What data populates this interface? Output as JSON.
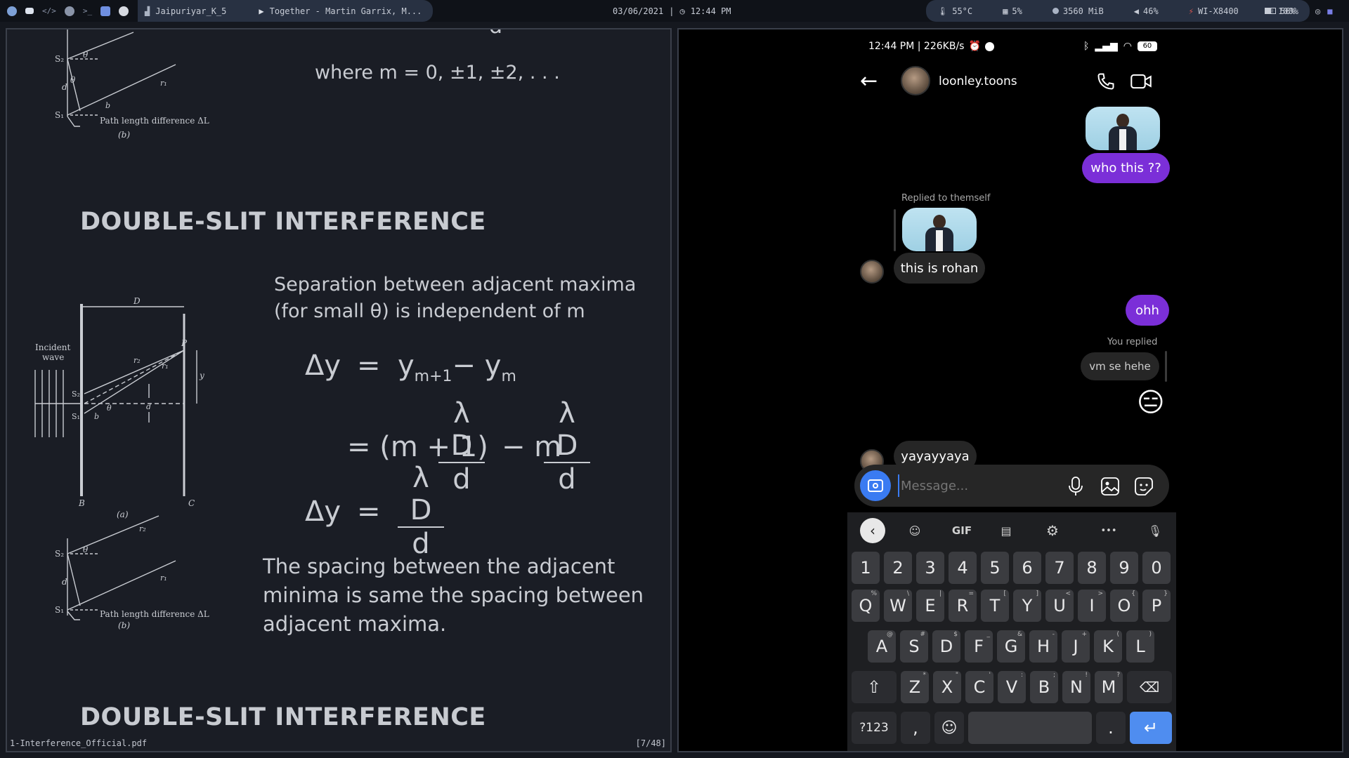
{
  "topbar": {
    "workspace_title": "Jaipuriyar_K_5",
    "media_title": "Together - Martin Garrix, M...",
    "date": "03/06/2021",
    "separator": "|",
    "time": "12:44 PM",
    "temp": "55°C",
    "cpu": "5%",
    "mem": "3560 MiB",
    "volume": "46%",
    "wifi": "WI-X8400",
    "brightness": "100%",
    "battery": "56%"
  },
  "pdf": {
    "top_cut_text": "d",
    "where_line": "where m = 0, ±1, ±2, . . .",
    "heading1": "DOUBLE-SLIT  INTERFERENCE",
    "heading2": "DOUBLE-SLIT  INTERFERENCE",
    "sep_line1": "Separation between adjacent maxima",
    "sep_line2": "(for small θ) is independent of m",
    "eq1_lhs": "Δy",
    "eq_equals": "=",
    "eq1_y": "y",
    "eq1_sub1": "m+1",
    "eq1_minus": "− y",
    "eq1_sub2": "m",
    "eq2_a": "= (m + 1)",
    "frac_num": "λ D",
    "frac_den": "d",
    "eq2_b": "− m",
    "eq3_lhs": "Δy",
    "spacing_line1": "The spacing between the adjacent",
    "spacing_line2": "minima is same the spacing between",
    "spacing_line3": "adjacent maxima.",
    "fig_labels": {
      "s1": "S₁",
      "s2": "S₂",
      "theta": "θ",
      "d": "d",
      "b": "b",
      "r1": "r₁",
      "r2": "r₂",
      "path_diff": "Path length difference ΔL",
      "caption_b": "(b)",
      "caption_a": "(a)",
      "incident": "Incident",
      "wave": "wave",
      "D": "D",
      "P": "P",
      "y": "y",
      "B": "B",
      "C": "C"
    },
    "filename": "1-Interference_Official.pdf",
    "page": "[7/48]"
  },
  "phone": {
    "status_left": "12:44 PM | 226KB/s",
    "battery_text": "60",
    "username": "loonley.toons",
    "messages": {
      "who": "who this ??",
      "replied_label": "Replied to themself",
      "rohan": "this is rohan",
      "ohh": "ohh",
      "you_replied": "You replied",
      "quoted": "vm se hehe",
      "emoji": "😑",
      "yaya": "yayayyaya"
    },
    "composer_placeholder": "Message...",
    "keyboard": {
      "gif": "GIF",
      "more": "•••",
      "row_numbers": [
        "1",
        "2",
        "3",
        "4",
        "5",
        "6",
        "7",
        "8",
        "9",
        "0"
      ],
      "row_q": [
        "Q",
        "W",
        "E",
        "R",
        "T",
        "Y",
        "U",
        "I",
        "O",
        "P"
      ],
      "row_q_hints": [
        "%",
        "\\",
        "|",
        "=",
        "[",
        "]",
        "<",
        ">",
        "{",
        "}"
      ],
      "row_a": [
        "A",
        "S",
        "D",
        "F",
        "G",
        "H",
        "J",
        "K",
        "L"
      ],
      "row_a_hints": [
        "@",
        "#",
        "$",
        "_",
        "&",
        "-",
        "+",
        "(",
        ")"
      ],
      "row_z": [
        "Z",
        "X",
        "C",
        "V",
        "B",
        "N",
        "M"
      ],
      "row_z_hints": [
        "*",
        "\"",
        "'",
        ":",
        ";",
        "!",
        "?"
      ],
      "sym": "?123",
      "comma": ",",
      "period": "."
    }
  }
}
